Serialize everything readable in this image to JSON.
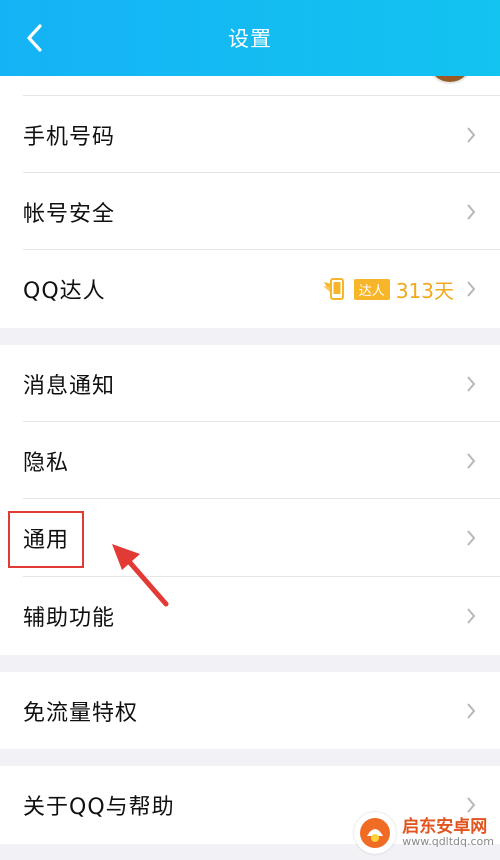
{
  "header": {
    "title": "设置",
    "background": "#14b3f5"
  },
  "sections": {
    "account": [
      {
        "label": "手机号码"
      },
      {
        "label": "帐号安全"
      },
      {
        "label": "QQ达人",
        "badge_tag": "达人",
        "badge_days": "313天"
      }
    ],
    "general": [
      {
        "label": "消息通知"
      },
      {
        "label": "隐私"
      },
      {
        "label": "通用"
      },
      {
        "label": "辅助功能"
      }
    ],
    "traffic": [
      {
        "label": "免流量特权"
      }
    ],
    "about": [
      {
        "label": "关于QQ与帮助"
      }
    ]
  },
  "annotation": {
    "highlight_color": "#e23a35"
  },
  "watermark": {
    "name": "启东安卓网",
    "url": "www.qdltdq.com"
  },
  "icons": {
    "back": "chevron-left-icon",
    "row_arrow": "chevron-right-icon",
    "badge": "daren-wing-phone-icon"
  },
  "colors": {
    "accent": "#14b3f5",
    "badge": "#f7b52a",
    "days_text": "#f2a81c",
    "page_bg": "#f2f2f6"
  }
}
